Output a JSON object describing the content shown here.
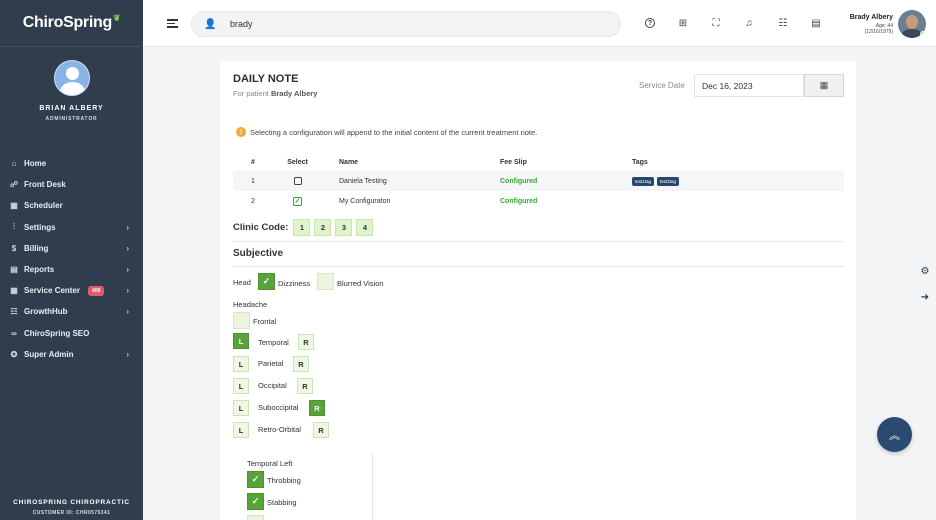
{
  "sidebar": {
    "brand": "ChiroSpring",
    "user_name": "BRIAN ALBERY",
    "user_role": "ADMINISTRATOR",
    "items": [
      {
        "label": "Home",
        "icon": "home-icon",
        "glyph": "⌂",
        "has_chevron": false
      },
      {
        "label": "Front Desk",
        "icon": "front-desk-icon",
        "glyph": "☍",
        "has_chevron": false
      },
      {
        "label": "Scheduler",
        "icon": "calendar-icon",
        "glyph": "▦",
        "has_chevron": false
      },
      {
        "label": "Settings",
        "icon": "sliders-icon",
        "glyph": "⫶",
        "has_chevron": true
      },
      {
        "label": "Billing",
        "icon": "dollar-icon",
        "glyph": "$",
        "has_chevron": true
      },
      {
        "label": "Reports",
        "icon": "document-icon",
        "glyph": "▤",
        "has_chevron": true
      },
      {
        "label": "Service Center",
        "icon": "grid-icon",
        "glyph": "▦",
        "has_chevron": true,
        "badge": "406"
      },
      {
        "label": "GrowthHub",
        "icon": "users-icon",
        "glyph": "☷",
        "has_chevron": true
      },
      {
        "label": "ChiroSpring SEO",
        "icon": "link-icon",
        "glyph": "∞",
        "has_chevron": false
      },
      {
        "label": "Super Admin",
        "icon": "gear-icon",
        "glyph": "✪",
        "has_chevron": true
      }
    ],
    "footer_title": "CHIROSPRING CHIROPRACTIC",
    "footer_customer": "CUSTOMER ID: CHR0575341"
  },
  "topbar": {
    "search_value": "brady",
    "user_name": "Brady Albery",
    "user_age": "Age: 44",
    "user_dob": "(12/16/1979)"
  },
  "note": {
    "title": "DAILY NOTE",
    "subtitle_prefix": "For patient",
    "patient": "Brady Albery",
    "service_date_label": "Service Date",
    "service_date": "Dec 16, 2023",
    "info": "Selecting a configuration will append to the initial content of the current treatment note.",
    "table_headers": {
      "num": "#",
      "select": "Select",
      "name": "Name",
      "fee": "Fee Slip",
      "tags": "Tags"
    },
    "rows": [
      {
        "num": "1",
        "checked": false,
        "name": "Daniela Testing",
        "fee": "Configured",
        "tags": [
          "test1tag",
          "test2tag"
        ]
      },
      {
        "num": "2",
        "checked": true,
        "name": "My Configuraton",
        "fee": "Configured",
        "tags": []
      }
    ],
    "clinic_code_label": "Clinic Code:",
    "clinic_codes": [
      "1",
      "2",
      "3",
      "4"
    ],
    "subjective_title": "Subjective",
    "head_label": "Head",
    "dizziness": "Dizziness",
    "blurred_vision": "Blurred Vision",
    "headache_label": "Headache",
    "frontal": "Frontal",
    "headache_items": [
      "Temporal",
      "Parietal",
      "Occipital",
      "Suboccipital",
      "Retro-Orbital"
    ],
    "left_letter": "L",
    "right_letter": "R",
    "temporal_left_title": "Temporal Left",
    "temporal_left_items": [
      "Throbbing",
      "Stabbing"
    ]
  }
}
